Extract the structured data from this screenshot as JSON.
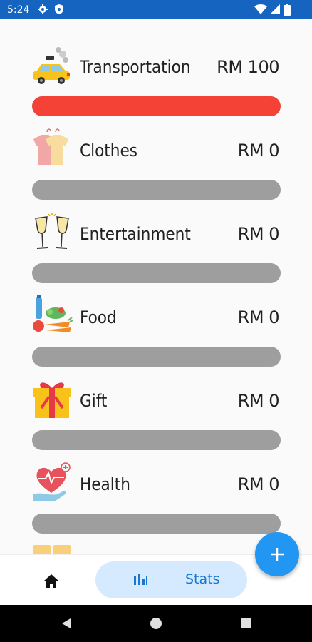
{
  "status_bar": {
    "time": "5:24",
    "icons": [
      "settings-icon",
      "shield-icon",
      "wifi-icon",
      "signal-icon",
      "battery-icon"
    ]
  },
  "categories": [
    {
      "name": "Transportation",
      "amount": "RM 100",
      "icon": "taxi-icon",
      "progress": 1.0
    },
    {
      "name": "Clothes",
      "amount": "RM 0",
      "icon": "shirts-icon",
      "progress": 0
    },
    {
      "name": "Entertainment",
      "amount": "RM 0",
      "icon": "champagne-icon",
      "progress": 0
    },
    {
      "name": "Food",
      "amount": "RM 0",
      "icon": "groceries-icon",
      "progress": 0
    },
    {
      "name": "Gift",
      "amount": "RM 0",
      "icon": "gift-icon",
      "progress": 0
    },
    {
      "name": "Health",
      "amount": "RM 0",
      "icon": "heart-health-icon",
      "progress": 0
    }
  ],
  "colors": {
    "accent": "#2196f3",
    "progress_fill": "#f44336",
    "progress_track": "#9e9e9e",
    "status_bar": "#1565c0"
  },
  "bottom_nav": {
    "home_icon": "home-icon",
    "stats_icon": "bar-chart-icon",
    "stats_label": "Stats"
  },
  "fab": {
    "icon": "plus-icon"
  },
  "system_nav": [
    "back-icon",
    "home-circle-icon",
    "recents-icon"
  ]
}
